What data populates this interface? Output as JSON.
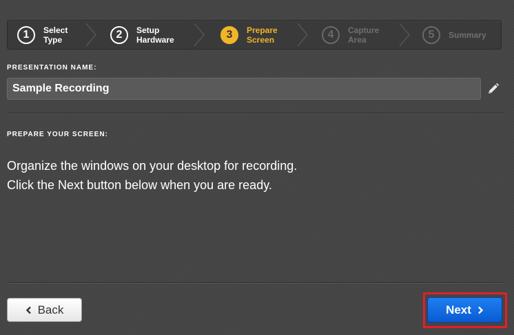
{
  "wizard": {
    "steps": [
      {
        "number": "1",
        "label": "Select\nType",
        "state": "done"
      },
      {
        "number": "2",
        "label": "Setup\nHardware",
        "state": "done"
      },
      {
        "number": "3",
        "label": "Prepare\nScreen",
        "state": "active"
      },
      {
        "number": "4",
        "label": "Capture\nArea",
        "state": "future"
      },
      {
        "number": "5",
        "label": "Summary",
        "state": "future"
      }
    ]
  },
  "presentation_name": {
    "label": "PRESENTATION NAME:",
    "value": "Sample Recording",
    "edit_icon": "pencil-icon"
  },
  "prepare": {
    "label": "PREPARE YOUR SCREEN:",
    "line1": "Organize the windows on your desktop for recording.",
    "line2": "Click the Next button below when you are ready."
  },
  "footer": {
    "back_label": "Back",
    "next_label": "Next"
  },
  "colors": {
    "active_step": "#f1b52a",
    "next_button": "#1573e8",
    "highlight": "#e0202a"
  }
}
